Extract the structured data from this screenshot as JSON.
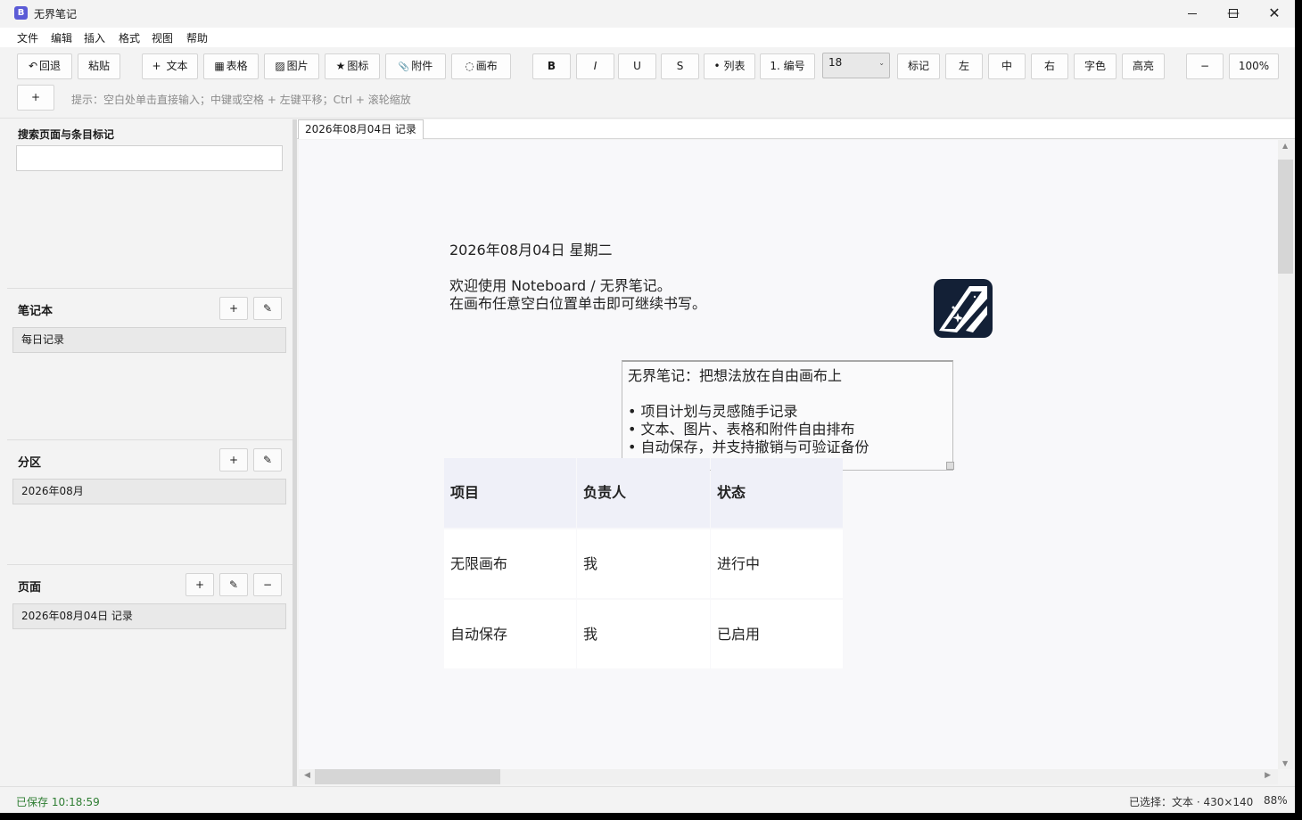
{
  "app": {
    "title": "无界笔记",
    "icon_letter": "B"
  },
  "window_controls": {
    "minimize": "—",
    "maximize": "☐",
    "close": "✕"
  },
  "menu": [
    "文件",
    "编辑",
    "插入",
    "格式",
    "视图",
    "帮助"
  ],
  "toolbar": {
    "undo": "回退",
    "undo_icon": "↶",
    "paste": "粘贴",
    "text": "文本",
    "text_icon": "+",
    "table": "表格",
    "table_icon": "▦",
    "image": "图片",
    "image_icon": "▨",
    "icon": "图标",
    "icon_icon": "★",
    "attachment": "附件",
    "attachment_icon": "📎",
    "canvas": "画布",
    "canvas_icon": "◌",
    "bold": "B",
    "italic": "I",
    "underline": "U",
    "strike": "S",
    "bullet_list": "• 列表",
    "numbered_list": "1. 编号",
    "font_size": "18",
    "mark": "标记",
    "align_left": "左",
    "align_center": "中",
    "align_right": "右",
    "font_color": "字色",
    "highlight": "高亮",
    "zoom_out": "−",
    "zoom": "100%",
    "add": "+",
    "hint": "提示：空白处单击直接输入；中键或空格 + 左键平移；Ctrl + 滚轮缩放"
  },
  "sidebar": {
    "search_label": "搜索页面与条目标记",
    "search_placeholder": "",
    "notebook_label": "笔记本",
    "notebook_item": "每日记录",
    "section_label": "分区",
    "section_item": "2026年08月",
    "page_label": "页面",
    "page_item": "2026年08月04日 记录",
    "add_btn": "+",
    "edit_btn": "✎",
    "remove_btn": "−"
  },
  "tab": {
    "label": "2026年08月04日 记录"
  },
  "canvas": {
    "date": "2026年08月04日 星期二",
    "welcome_1": "欢迎使用 Noteboard / 无界笔记。",
    "welcome_2": "在画布任意空白位置单击即可继续书写。",
    "textbox": {
      "title": "无界笔记：把想法放在自由画布上",
      "items": [
        "• 项目计划与灵感随手记录",
        "• 文本、图片、表格和附件自由排布",
        "• 自动保存，并支持撤销与可验证备份"
      ]
    },
    "table": {
      "headers": [
        "项目",
        "负责人",
        "状态"
      ],
      "rows": [
        [
          "无限画布",
          "我",
          "进行中"
        ],
        [
          "自动保存",
          "我",
          "已启用"
        ]
      ]
    }
  },
  "status": {
    "saved": "已保存  10:18:59",
    "selection": "已选择：文本 · 430×140",
    "zoom": "88%"
  }
}
